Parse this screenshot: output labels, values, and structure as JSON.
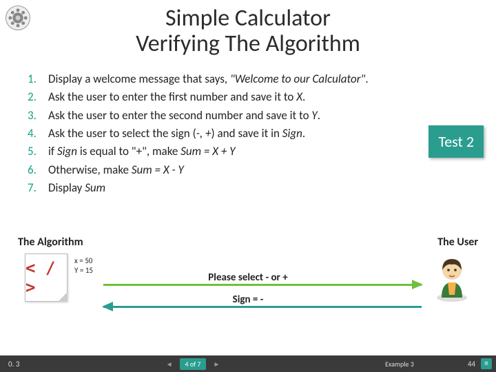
{
  "title": {
    "line1": "Simple Calculator",
    "line2": "Verifying The Algorithm"
  },
  "steps": [
    {
      "n": "1.",
      "pre": "Display a welcome message that says, ",
      "ital": "\"Welcome to our Calculator\"",
      "post": "."
    },
    {
      "n": "2.",
      "pre": "Ask the user to enter the first number and save it to ",
      "ital": "X",
      "post": "."
    },
    {
      "n": "3.",
      "pre": "Ask the user to enter the second number and save it to ",
      "ital": "Y",
      "post": "."
    },
    {
      "n": "4.",
      "pre": "Ask the user to select the sign (",
      "ital": "-, +",
      "post_a": ") and save it in ",
      "ital2": "Sign",
      "post": "."
    },
    {
      "n": "5.",
      "pre": "if ",
      "ital": "Sign",
      "post_a": " is equal to \"+\", make ",
      "ital2": "Sum = X + Y",
      "post": ""
    },
    {
      "n": "6.",
      "pre": "Otherwise, make ",
      "ital": "Sum = X - Y",
      "post": ""
    },
    {
      "n": "7.",
      "pre": "Display ",
      "ital": "Sum",
      "post": ""
    }
  ],
  "badge": "Test 2",
  "labels": {
    "left": "The Algorithm",
    "right": "The User"
  },
  "vars": {
    "x": "x = 50",
    "y": "Y = 15"
  },
  "code_glyph": "< / >",
  "messages": {
    "prompt": "Please select - or +",
    "reply": "Sign = -"
  },
  "footer": {
    "version": "0. 3",
    "page": "4 of 7",
    "example": "Example 3",
    "slide": "44",
    "prev": "◄",
    "next": "►",
    "menu": "≡"
  }
}
